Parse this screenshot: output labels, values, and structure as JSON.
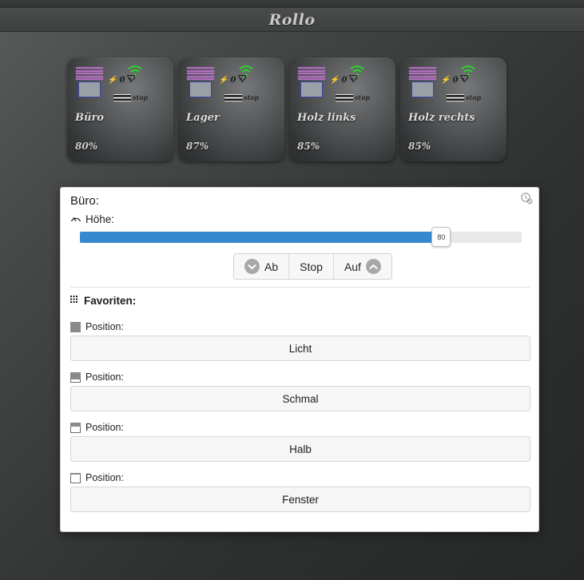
{
  "header": {
    "title": "Rollo"
  },
  "cards": [
    {
      "name": "Büro",
      "percent": "80%",
      "power": "0",
      "status": "stop",
      "blind_icon": "blinds-icon",
      "wifi_icon": "wifi-icon",
      "bolt_icon": "bolt-icon"
    },
    {
      "name": "Lager",
      "percent": "87%",
      "power": "0",
      "status": "stop",
      "blind_icon": "blinds-icon",
      "wifi_icon": "wifi-icon",
      "bolt_icon": "bolt-icon"
    },
    {
      "name": "Holz links",
      "percent": "85%",
      "power": "0",
      "status": "stop",
      "blind_icon": "blinds-icon",
      "wifi_icon": "wifi-icon",
      "bolt_icon": "bolt-icon"
    },
    {
      "name": "Holz rechts",
      "percent": "85%",
      "power": "0",
      "status": "stop",
      "blind_icon": "blinds-icon",
      "wifi_icon": "wifi-icon",
      "bolt_icon": "bolt-icon"
    }
  ],
  "panel": {
    "title": "Büro:",
    "corner_icon": "schedule-settings-icon",
    "height_label": "Höhe:",
    "height_icon": "gauge-icon",
    "slider": {
      "value": "80",
      "min": 0,
      "max": 100,
      "fill_color": "#3789cf",
      "track_color": "#e8e8e8"
    },
    "controls": [
      {
        "label": "Ab",
        "icon": "chevron-down-circle-icon",
        "icon_side": "left"
      },
      {
        "label": "Stop",
        "icon": "",
        "icon_side": ""
      },
      {
        "label": "Auf",
        "icon": "chevron-up-circle-icon",
        "icon_side": "right"
      }
    ],
    "favorites_label": "Favoriten:",
    "favorites_icon": "grid-dots-icon",
    "favorites": [
      {
        "position_label": "Position:",
        "button_label": "Licht",
        "icon": "blind-closed-icon",
        "fill_pct": 100
      },
      {
        "position_label": "Position:",
        "button_label": "Schmal",
        "icon": "blind-narrow-icon",
        "fill_pct": 72
      },
      {
        "position_label": "Position:",
        "button_label": "Halb",
        "icon": "blind-half-icon",
        "fill_pct": 42
      },
      {
        "position_label": "Position:",
        "button_label": "Fenster",
        "icon": "blind-open-icon",
        "fill_pct": 22
      }
    ]
  }
}
